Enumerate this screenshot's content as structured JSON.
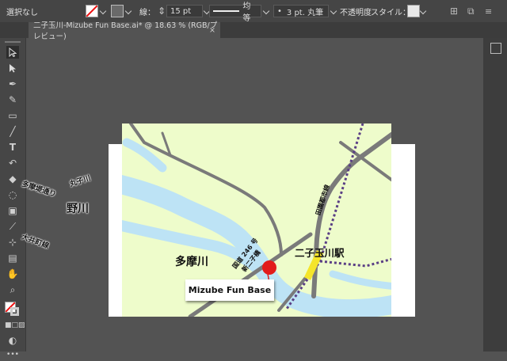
{
  "control_bar": {
    "selection_status": "選択なし",
    "stroke_label": "線：",
    "stroke_weight": "15 pt",
    "stroke_profile": "均等",
    "brush_label": "3 pt. 丸筆",
    "opacity_label": "不透明度",
    "style_label": "スタイル："
  },
  "document_tab": {
    "title": "二子玉川-Mizube Fun Base.ai* @ 18.63 % (RGB/プレビュー)",
    "close_glyph": "×"
  },
  "map": {
    "river_label": "多摩川",
    "station_label": "二子玉川駅",
    "railway_label": "田園都市線",
    "route_label_1": "国道 246 号",
    "route_label_2": "新二子橋",
    "callout": "Mizube Fun Base",
    "outside_label_1": "野川",
    "outside_label_2": "丸子川",
    "outside_label_3": "多摩堤通り",
    "outside_label_4": "大井町線"
  },
  "toolbar": {
    "more_glyph": "•••"
  },
  "colors": {
    "map_background": "#eefccb",
    "river": "#bde3f5",
    "road": "#7a7a7a",
    "railway": "#5a3f85",
    "station_highlight": "#f5e52a",
    "marker": "#e21b1b"
  }
}
